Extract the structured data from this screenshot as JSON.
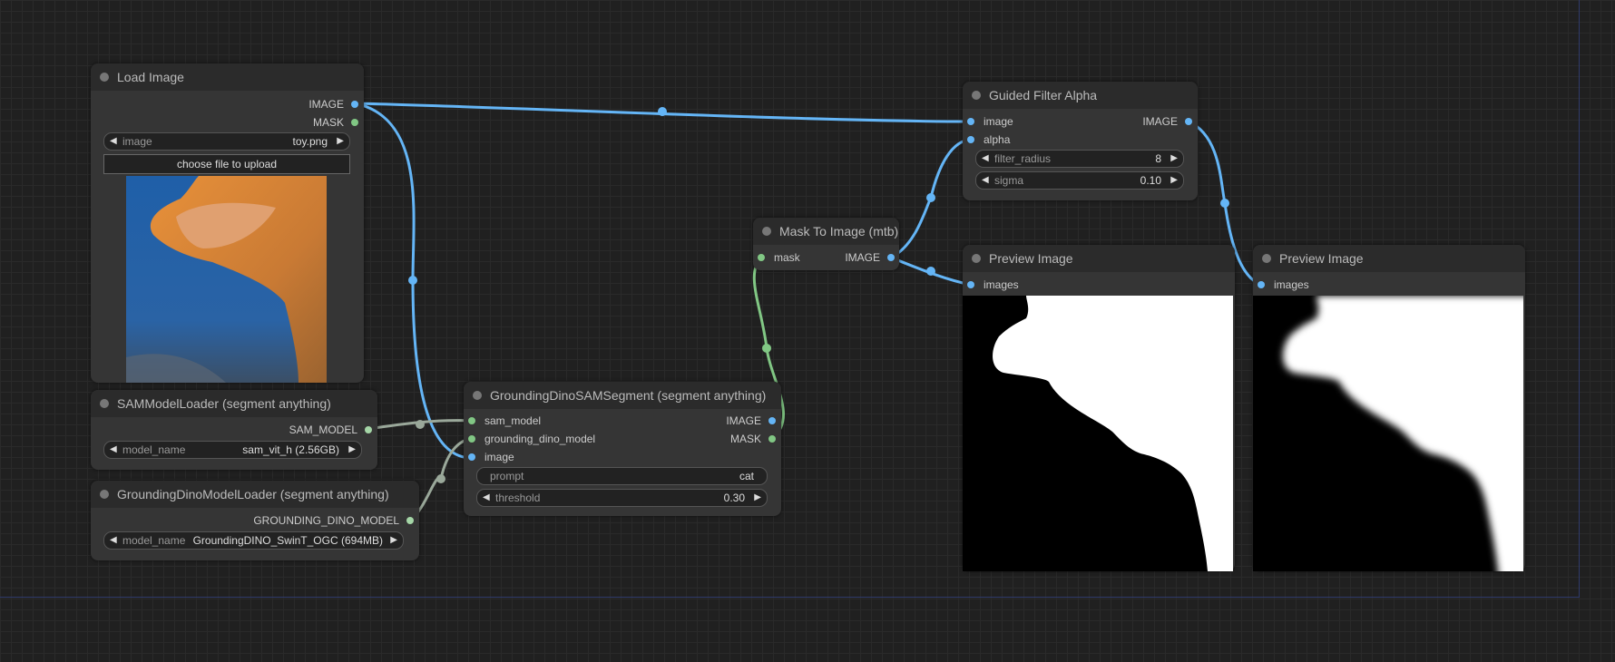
{
  "nodes": {
    "load_image": {
      "title": "Load Image",
      "outputs": [
        "IMAGE",
        "MASK"
      ],
      "widget_label": "image",
      "widget_value": "toy.png",
      "upload_label": "choose file to upload",
      "preview": "cat-ear-photo"
    },
    "sam_loader": {
      "title": "SAMModelLoader (segment anything)",
      "output": "SAM_MODEL",
      "widget_label": "model_name",
      "widget_value": "sam_vit_h (2.56GB)"
    },
    "dino_loader": {
      "title": "GroundingDinoModelLoader (segment anything)",
      "output": "GROUNDING_DINO_MODEL",
      "widget_label": "model_name",
      "widget_value": "GroundingDINO_SwinT_OGC (694MB)"
    },
    "segment": {
      "title": "GroundingDinoSAMSegment (segment anything)",
      "inputs": [
        "sam_model",
        "grounding_dino_model",
        "image"
      ],
      "outputs": [
        "IMAGE",
        "MASK"
      ],
      "prompt_label": "prompt",
      "prompt_value": "cat",
      "threshold_label": "threshold",
      "threshold_value": "0.30"
    },
    "mask_to_image": {
      "title": "Mask To Image (mtb)",
      "input": "mask",
      "output": "IMAGE"
    },
    "guided_filter": {
      "title": "Guided Filter Alpha",
      "inputs": [
        "image",
        "alpha"
      ],
      "output": "IMAGE",
      "radius_label": "filter_radius",
      "radius_value": "8",
      "sigma_label": "sigma",
      "sigma_value": "0.10"
    },
    "preview1": {
      "title": "Preview Image",
      "input": "images"
    },
    "preview2": {
      "title": "Preview Image",
      "input": "images"
    }
  },
  "colors": {
    "image_link": "#64b5f6",
    "mask_link": "#81c784",
    "model_link": "#9aa89a"
  }
}
